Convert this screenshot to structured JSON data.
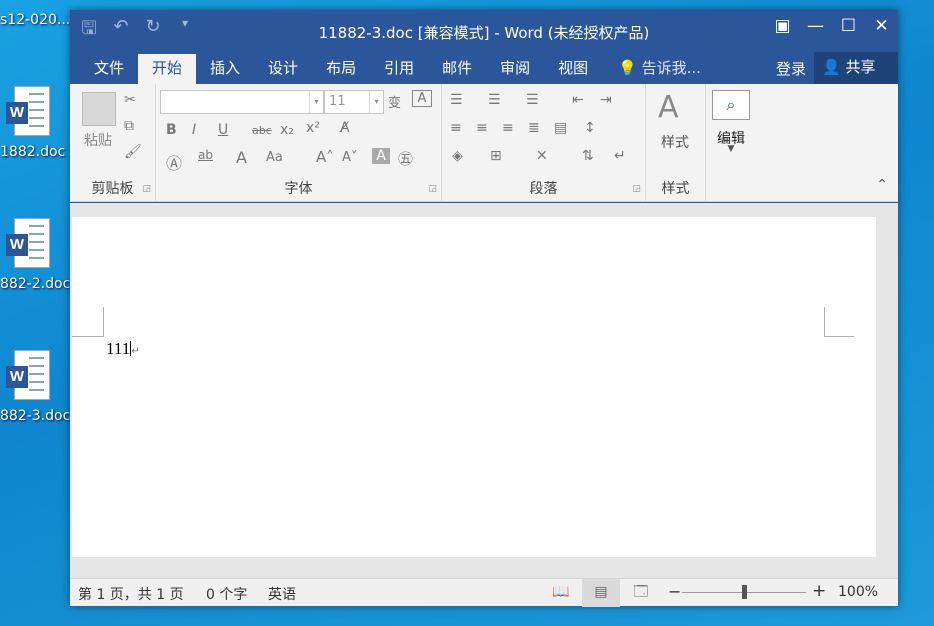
{
  "desktop": {
    "top_label": "s12-020...",
    "icons": [
      {
        "label": "1882.doc",
        "badge": "W"
      },
      {
        "label": "882-2.doc",
        "badge": "W"
      },
      {
        "label": "882-3.doc",
        "badge": "W"
      }
    ]
  },
  "window": {
    "title": "11882-3.doc [兼容模式] - Word (未经授权产品)",
    "qat": {
      "save_icon": "save-icon",
      "undo_icon": "undo-icon",
      "redo_icon": "redo-icon",
      "customize_icon": "customize-icon"
    },
    "controls": {
      "ribbon_display": "▣",
      "minimize": "—",
      "maximize": "☐",
      "close": "✕"
    }
  },
  "tabs": [
    "文件",
    "开始",
    "插入",
    "设计",
    "布局",
    "引用",
    "邮件",
    "审阅",
    "视图"
  ],
  "active_tab": "开始",
  "tell_me": "告诉我...",
  "login": "登录",
  "share": "共享",
  "ribbon": {
    "clipboard": {
      "name": "剪贴板",
      "paste": "粘贴"
    },
    "font": {
      "name": "字体",
      "font_family": "",
      "font_size": "11"
    },
    "paragraph": {
      "name": "段落"
    },
    "styles": {
      "name": "样式",
      "button": "样式"
    },
    "editing": {
      "button": "编辑"
    }
  },
  "document": {
    "text": "111"
  },
  "status": {
    "page": "第 1 页，共 1 页",
    "words": "0 个字",
    "language": "英语",
    "zoom": "100%",
    "zoom_level": 1.0
  },
  "colors": {
    "accent": "#2b579a",
    "ribbon_bg": "#f3f3f3",
    "desktop": "#1aa2e3"
  }
}
